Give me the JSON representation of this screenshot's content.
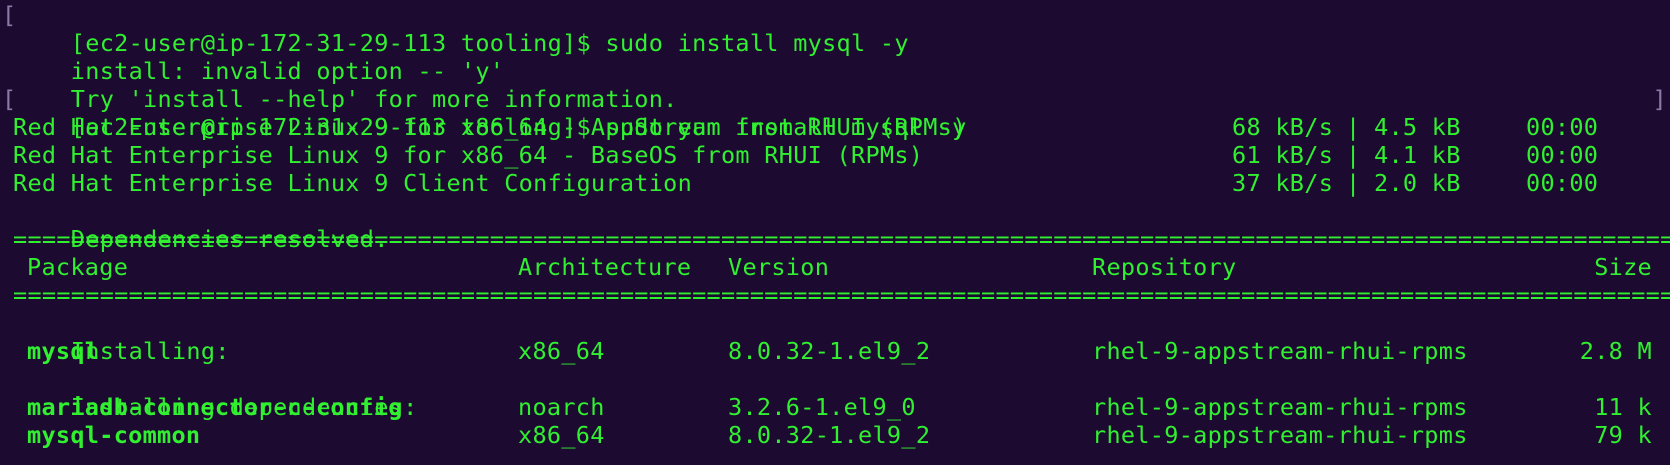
{
  "lines": [
    {
      "type": "prompt",
      "text": "[ec2-user@ip-172-31-29-113 tooling]$ sudo install mysql -y"
    },
    {
      "type": "output",
      "text": "install: invalid option -- 'y'"
    },
    {
      "type": "output",
      "text": "Try 'install --help' for more information."
    },
    {
      "type": "prompt",
      "text": "[ec2-user@ip-172-31-29-113 tooling]$ sudo yum install mysql -y"
    }
  ],
  "repos": [
    {
      "name": "Red Hat Enterprise Linux 9 for x86_64 - AppStream from RHUI (RPMs)",
      "speed": "68 kB/s",
      "size": "4.5 kB",
      "time": "00:00"
    },
    {
      "name": "Red Hat Enterprise Linux 9 for x86_64 - BaseOS from RHUI (RPMs)",
      "speed": "61 kB/s",
      "size": "4.1 kB",
      "time": "00:00"
    },
    {
      "name": "Red Hat Enterprise Linux 9 Client Configuration",
      "speed": "37 kB/s",
      "size": "2.0 kB",
      "time": "00:00"
    }
  ],
  "resolved": "Dependencies resolved.",
  "rule": "================================================================================================================================================================================================",
  "separator": "|",
  "table": {
    "headers": {
      "package": "Package",
      "arch": "Architecture",
      "version": "Version",
      "repo": "Repository",
      "size": "Size"
    },
    "groups": [
      {
        "label": "Installing:",
        "rows": [
          {
            "package": "mysql",
            "arch": "x86_64",
            "version": "8.0.32-1.el9_2",
            "repo": "rhel-9-appstream-rhui-rpms",
            "size": "2.8 M"
          }
        ]
      },
      {
        "label": "Installing dependencies:",
        "rows": [
          {
            "package": "mariadb-connector-c-config",
            "arch": "noarch",
            "version": "3.2.6-1.el9_0",
            "repo": "rhel-9-appstream-rhui-rpms",
            "size": "11 k"
          },
          {
            "package": "mysql-common",
            "arch": "x86_64",
            "version": "8.0.32-1.el9_2",
            "repo": "rhel-9-appstream-rhui-rpms",
            "size": "79 k"
          }
        ]
      }
    ]
  },
  "colors": {
    "background": "#1d0a31",
    "text": "#30f030"
  }
}
